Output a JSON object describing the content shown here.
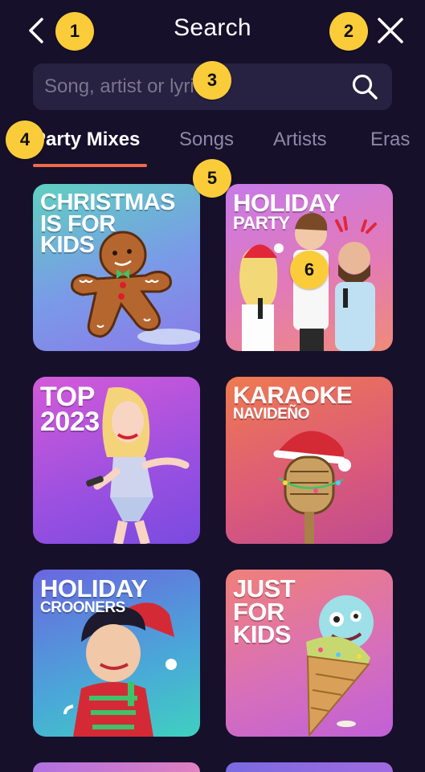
{
  "header": {
    "title": "Search"
  },
  "search": {
    "placeholder": "Song, artist or lyrics..."
  },
  "tabs": [
    {
      "label": "Party Mixes",
      "active": true
    },
    {
      "label": "Songs",
      "active": false
    },
    {
      "label": "Artists",
      "active": false
    },
    {
      "label": "Eras",
      "active": false
    }
  ],
  "tiles": [
    {
      "line1": "CHRISTMAS",
      "line2": "IS FOR",
      "line3": "KIDS",
      "colors": [
        "#5fd0c0",
        "#7d7ae8"
      ]
    },
    {
      "line1": "HOLIDAY",
      "line2": "PARTY",
      "colors": [
        "#c77ae8",
        "#f08878"
      ]
    },
    {
      "line1": "TOP",
      "line2": "2023",
      "colors": [
        "#d05ad8",
        "#7d4ae0"
      ]
    },
    {
      "line1": "KARAOKE",
      "line2": "NAVIDEÑO",
      "colors": [
        "#ee7a50",
        "#c04a90"
      ]
    },
    {
      "line1": "HOLIDAY",
      "line2": "CROONERS",
      "colors": [
        "#6a6ae0",
        "#3fd0c0"
      ]
    },
    {
      "line1": "JUST",
      "line2": "FOR",
      "line3": "KIDS",
      "colors": [
        "#f08078",
        "#c060d8"
      ]
    }
  ],
  "annotations": [
    "1",
    "2",
    "3",
    "4",
    "5",
    "6"
  ]
}
